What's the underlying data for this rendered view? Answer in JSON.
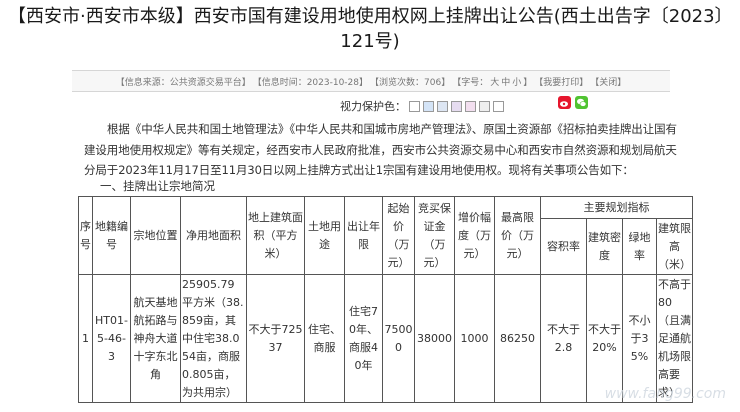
{
  "title": {
    "line1": "【西安市·西安市本级】西安市国有建设用地使用权网上挂牌出让公告(西土出告字〔2023〕",
    "line2": "121号)"
  },
  "meta": {
    "source": "【信息来源：公共资源交易平台】",
    "time": "【信息时间：2023-10-28】",
    "views": "【浏览次数：706】",
    "font_label": "【字号：",
    "font_big": "大",
    "font_mid": "中",
    "font_small": "小",
    "font_end": "】",
    "print": "【打印】",
    "close": "【关闭】",
    "print_prefix": "【我要打印】"
  },
  "eye_protect": {
    "label": "视力保护色：",
    "colors": [
      "#ffffff",
      "#fafad2",
      "#dbe8f5",
      "#e6e6fa",
      "#e8d8f0",
      "#f0f0f0",
      "#ffffff"
    ]
  },
  "share": {
    "weibo": "weibo-icon",
    "wechat": "wechat-icon"
  },
  "body": {
    "paragraph": "根据《中华人民共和国土地管理法》《中华人民共和国城市房地产管理法》、原国土资源部《招标拍卖挂牌出让国有建设用地使用权规定》等有关规定，经西安市人民政府批准，西安市公共资源交易中心和西安市自然资源和规划局航天分局于2023年11月17日至11月30日以网上挂牌方式出让1宗国有建设用地使用权。现将有关事项公告如下：",
    "section1": "一、挂牌出让宗地简况"
  },
  "table": {
    "headers": {
      "seq": "序号",
      "code": "地籍编号",
      "location": "宗地位置",
      "area": "净用地面积",
      "floor_area": "地上建筑面积（平方米）",
      "use": "土地用途",
      "years": "出让年限",
      "start_price": "起始价（万元）",
      "deposit": "竞买保证金（万元）",
      "increment": "增价幅度（万元）",
      "max_price": "最高限价（万元）",
      "main_indicators": "主要规划指标",
      "far": "容积率",
      "density": "建筑密度",
      "green": "绿地率",
      "height": "建筑限高（米）"
    },
    "rows": [
      {
        "seq": "1",
        "code": "HT01-5-46-3",
        "location": "航天基地航拓路与神舟大道十字东北角",
        "area": "25905.79平方米（38.859亩，其中住宅38.054亩，商服0.805亩，为共用宗）",
        "floor_area": "不大于72537",
        "use": "住宅、商服",
        "years": "住宅70年、商服40年",
        "start_price": "75000",
        "deposit": "38000",
        "increment": "1000",
        "max_price": "86250",
        "far": "不大于2.8",
        "density": "不大于20%",
        "green": "不小于35%",
        "height": "不高于80（且满足通航机场限高要求）"
      }
    ]
  },
  "watermark": "www.fang99.com"
}
